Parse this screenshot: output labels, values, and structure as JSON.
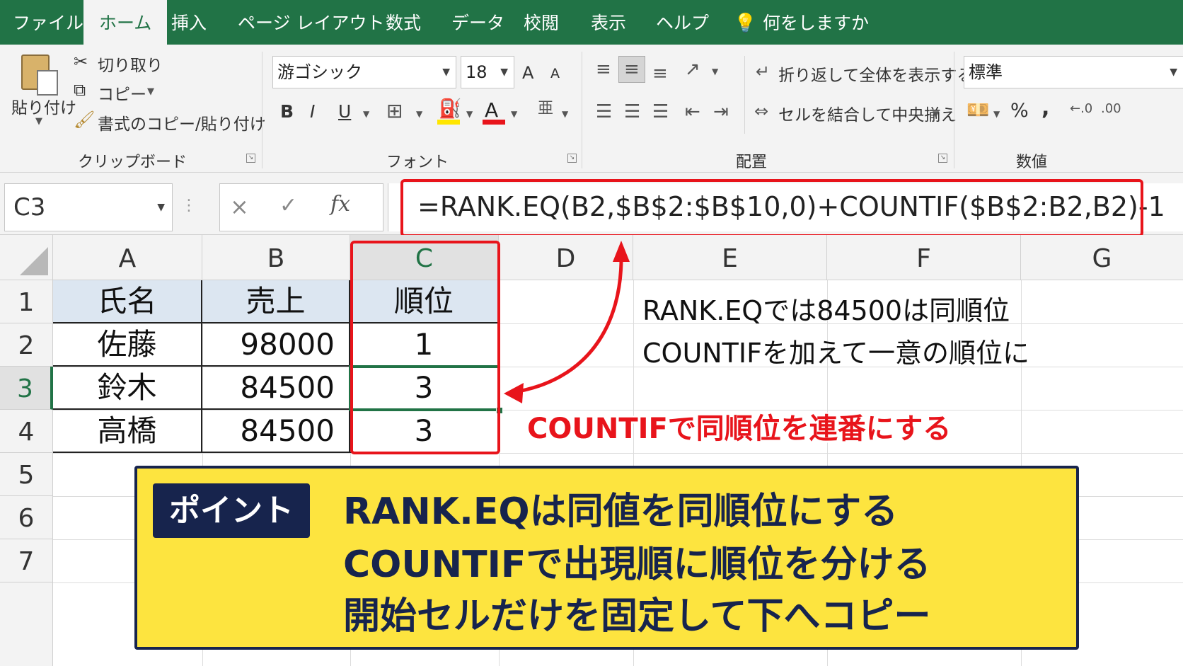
{
  "tabs": [
    "ファイル",
    "ホーム",
    "挿入",
    "ページ レイアウト",
    "数式",
    "データ",
    "校閲",
    "表示",
    "ヘルプ"
  ],
  "tell_me": "何をしますか",
  "clipboard": {
    "paste": "貼り付け",
    "cut": "切り取り",
    "copy": "コピー",
    "format_painter": "書式のコピー/貼り付け",
    "group": "クリップボード"
  },
  "font": {
    "name": "游ゴシック",
    "size": "18",
    "bold": "B",
    "italic": "I",
    "underline": "U",
    "color_letter": "A",
    "grow": "A",
    "shrink": "A",
    "group": "フォント"
  },
  "alignment": {
    "wrap": "折り返して全体を表示する",
    "merge": "セルを結合して中央揃え",
    "group": "配置"
  },
  "number": {
    "format": "標準",
    "percent": "%",
    "comma": ",",
    "group": "数値"
  },
  "name_box": "C3",
  "formula_icons": {
    "cancel": "×",
    "enter": "✓",
    "fx": "fx"
  },
  "formula": "=RANK.EQ(B2,$B$2:$B$10,0)+COUNTIF($B$2:B2,B2)-1",
  "columns": [
    "A",
    "B",
    "C",
    "D",
    "E",
    "F",
    "G"
  ],
  "rows": [
    "1",
    "2",
    "3",
    "4",
    "5",
    "6",
    "7"
  ],
  "table": {
    "headers": [
      "氏名",
      "売上",
      "順位"
    ],
    "rows": [
      [
        "佐藤",
        "98000",
        "1"
      ],
      [
        "鈴木",
        "84500",
        "3"
      ],
      [
        "高橋",
        "84500",
        "3"
      ]
    ]
  },
  "notes": [
    "RANK.EQでは84500は同順位",
    "COUNTIFを加えて一意の順位に"
  ],
  "annotation": "COUNTIFで同順位を連番にする",
  "point": {
    "badge": "ポイント",
    "lines": [
      "RANK.EQは同値を同順位にする",
      "COUNTIFで出現順に順位を分ける",
      "開始セルだけを固定して下へコピー"
    ]
  },
  "colors": {
    "excel_green": "#217346",
    "highlight_red": "#e8141b",
    "point_yellow": "#fde43f",
    "point_navy": "#17244d",
    "header_blue": "#dce6f1"
  }
}
